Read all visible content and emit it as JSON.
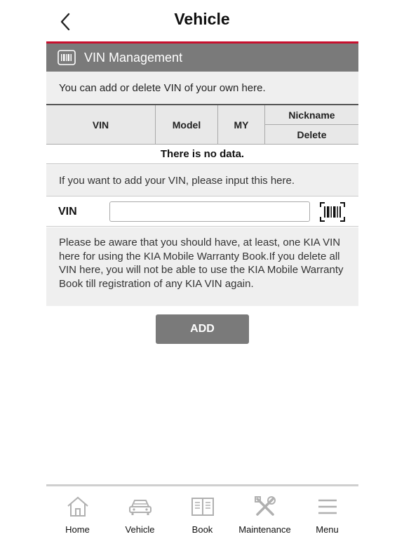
{
  "header": {
    "title": "Vehicle",
    "back_icon": "chevron-left-icon"
  },
  "section": {
    "title": "VIN Management",
    "icon": "barcode-card-icon"
  },
  "info_text": "You can add or delete VIN of your own here.",
  "table": {
    "columns": {
      "vin": "VIN",
      "model": "Model",
      "my": "MY",
      "nickname": "Nickname",
      "delete": "Delete"
    },
    "empty_text": "There is no data."
  },
  "add_info_text": "If you want to add your VIN, please input this here.",
  "vin_field": {
    "label": "VIN",
    "value": "",
    "placeholder": ""
  },
  "warning_text": "Please be aware that you should have, at least, one KIA VIN here for using the KIA Mobile Warranty Book.If you delete all VIN here, you will not be able to use the KIA Mobile Warranty Book till registration of any KIA VIN again.",
  "add_button": "ADD",
  "nav": [
    {
      "label": "Home",
      "icon": "home-icon"
    },
    {
      "label": "Vehicle",
      "icon": "car-icon"
    },
    {
      "label": "Book",
      "icon": "book-icon"
    },
    {
      "label": "Maintenance",
      "icon": "tools-icon"
    },
    {
      "label": "Menu",
      "icon": "hamburger-menu-icon"
    }
  ],
  "colors": {
    "accent_red": "#c8102e",
    "bar_gray": "#7a7a7a",
    "panel_gray": "#efefef",
    "icon_gray": "#b0b0b0"
  }
}
